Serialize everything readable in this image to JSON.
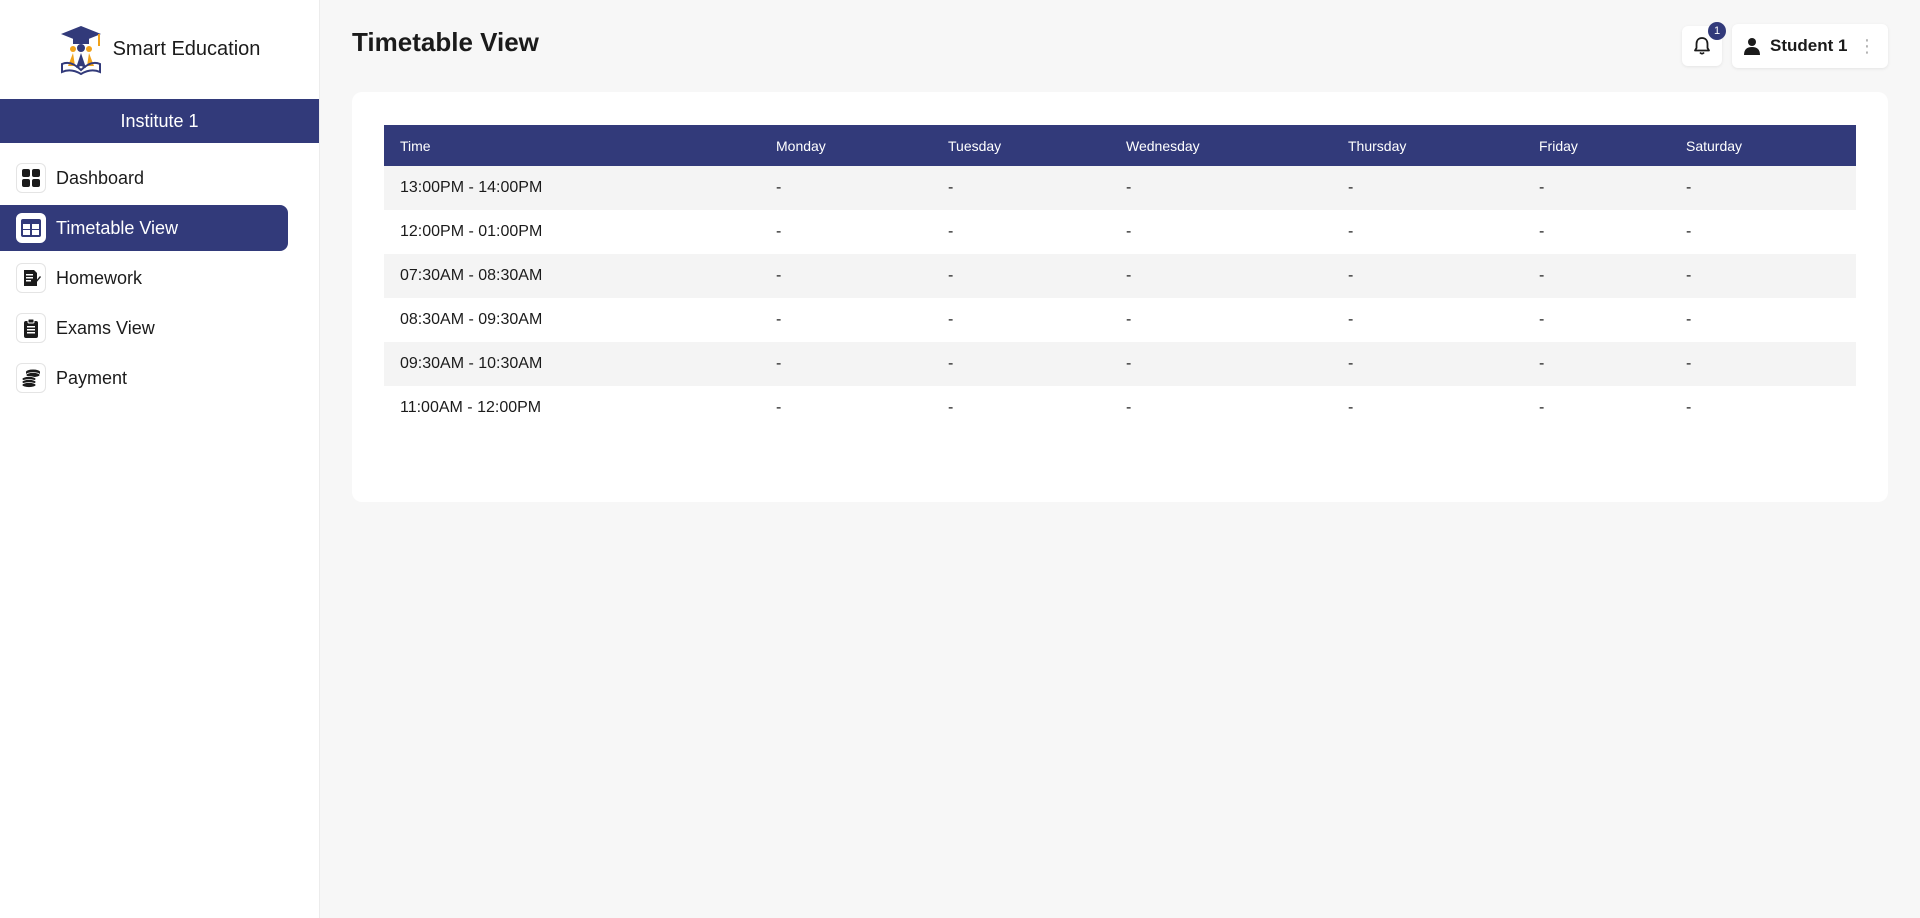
{
  "brand": {
    "name": "Smart Education"
  },
  "institute": "Institute 1",
  "sidebar": {
    "items": [
      {
        "label": "Dashboard",
        "icon": "dashboard-icon",
        "active": false
      },
      {
        "label": "Timetable View",
        "icon": "timetable-icon",
        "active": true
      },
      {
        "label": "Homework",
        "icon": "homework-icon",
        "active": false
      },
      {
        "label": "Exams View",
        "icon": "clipboard-icon",
        "active": false
      },
      {
        "label": "Payment",
        "icon": "coins-icon",
        "active": false
      }
    ]
  },
  "header": {
    "title": "Timetable View",
    "notification_count": "1",
    "user_name": "Student 1"
  },
  "timetable": {
    "columns": [
      "Time",
      "Monday",
      "Tuesday",
      "Wednesday",
      "Thursday",
      "Friday",
      "Saturday"
    ],
    "rows": [
      [
        "13:00PM - 14:00PM",
        "-",
        "-",
        "-",
        "-",
        "-",
        "-"
      ],
      [
        "12:00PM - 01:00PM",
        "-",
        "-",
        "-",
        "-",
        "-",
        "-"
      ],
      [
        "07:30AM - 08:30AM",
        "-",
        "-",
        "-",
        "-",
        "-",
        "-"
      ],
      [
        "08:30AM - 09:30AM",
        "-",
        "-",
        "-",
        "-",
        "-",
        "-"
      ],
      [
        "09:30AM - 10:30AM",
        "-",
        "-",
        "-",
        "-",
        "-",
        "-"
      ],
      [
        "11:00AM - 12:00PM",
        "-",
        "-",
        "-",
        "-",
        "-",
        "-"
      ]
    ]
  },
  "colors": {
    "primary": "#323a7a",
    "accent": "#f0a21b",
    "background": "#f7f7f7"
  }
}
